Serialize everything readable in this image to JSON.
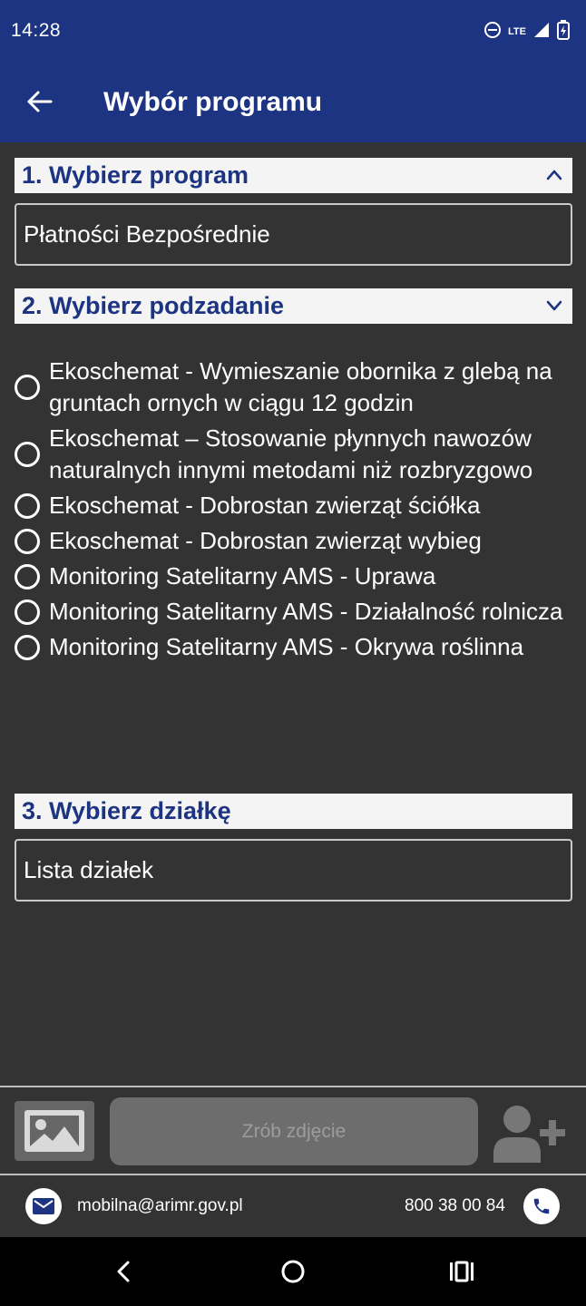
{
  "status_bar": {
    "time": "14:28",
    "network": "LTE"
  },
  "app_bar": {
    "title": "Wybór programu"
  },
  "sections": {
    "program": {
      "title": "1. Wybierz program",
      "value": "Płatności Bezpośrednie"
    },
    "subtask": {
      "title": "2. Wybierz podzadanie"
    },
    "parcel": {
      "title": "3. Wybierz działkę",
      "value": "Lista działek"
    }
  },
  "options": [
    {
      "label": "Ekoschemat - Wymieszanie obornika z glebą na gruntach ornych w ciągu 12 godzin"
    },
    {
      "label": "Ekoschemat – Stosowanie płynnych nawozów naturalnych innymi metodami niż rozbryzgowo"
    },
    {
      "label": "Ekoschemat - Dobrostan zwierząt ściółka"
    },
    {
      "label": "Ekoschemat - Dobrostan zwierząt wybieg"
    },
    {
      "label": "Monitoring Satelitarny AMS - Uprawa"
    },
    {
      "label": "Monitoring Satelitarny AMS - Działalność rolnicza"
    },
    {
      "label": "Monitoring Satelitarny AMS - Okrywa roślinna"
    }
  ],
  "bottom_bar": {
    "take_photo_label": "Zrób zdjęcie"
  },
  "contact": {
    "email": "mobilna@arimr.gov.pl",
    "phone": "800 38 00 84"
  },
  "colors": {
    "primary": "#1c3481",
    "background": "#333333",
    "header_bg": "#f4f4f4"
  }
}
